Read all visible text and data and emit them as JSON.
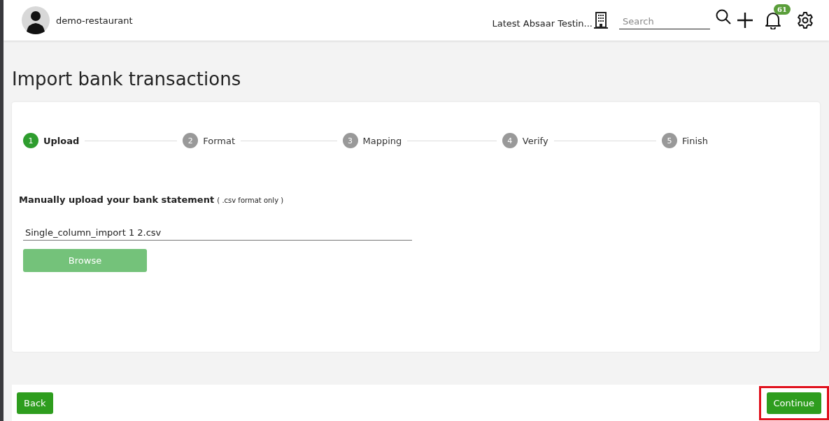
{
  "header": {
    "account_name": "demo-restaurant",
    "company": "Latest Absaar Testin...",
    "search": {
      "placeholder": "Search"
    },
    "notifications_count": "61"
  },
  "page_title": "Import bank transactions",
  "steps": [
    {
      "number": "1",
      "label": "Upload",
      "selected": true
    },
    {
      "number": "2",
      "label": "Format",
      "selected": false
    },
    {
      "number": "3",
      "label": "Mapping",
      "selected": false
    },
    {
      "number": "4",
      "label": "Verify",
      "selected": false
    },
    {
      "number": "5",
      "label": "Finish",
      "selected": false
    }
  ],
  "upload": {
    "label": "Manually upload your bank statement",
    "hint": "( .csv format only )",
    "file_name": "Single_column_import 1 2.csv",
    "browse_button": {
      "label": "Browse",
      "disabled": true
    }
  },
  "footer": {
    "back_button": {
      "label": "Back"
    },
    "continue_button": {
      "label": "Continue",
      "highlighted": true
    }
  }
}
